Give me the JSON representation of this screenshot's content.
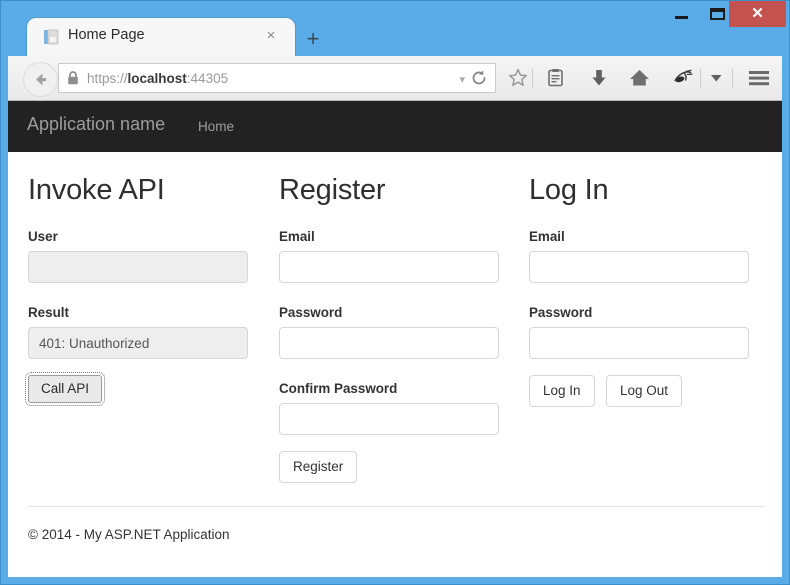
{
  "window": {
    "controls": {
      "minimize_label": "—",
      "maximize_label": "",
      "close_label": "✕"
    },
    "close_color": "#c4534f",
    "titlebar_color": "#5aace8"
  },
  "browser": {
    "tab": {
      "title": "Home Page",
      "close_label": "×",
      "favicon": "page-icon"
    },
    "new_tab_label": "+",
    "back_label": "back-arrow-icon",
    "url": {
      "scheme": "https://",
      "host": "localhost",
      "port": ":44305",
      "full": "https://localhost:44305",
      "lock": "padlock-icon",
      "dropdown_label": "▾",
      "reload_label": "reload-icon"
    },
    "toolbar_icons": [
      {
        "name": "star-icon",
        "label": "Bookmark"
      },
      {
        "name": "reader-icon",
        "label": "Reader view"
      },
      {
        "name": "download-icon",
        "label": "Downloads"
      },
      {
        "name": "home-icon",
        "label": "Home"
      },
      {
        "name": "pocket-icon",
        "label": "Pocket"
      },
      {
        "name": "chevron-down-icon",
        "label": "More"
      },
      {
        "name": "hamburger-menu-icon",
        "label": "Menu"
      }
    ]
  },
  "site": {
    "navbar": {
      "brand": "Application name",
      "links": [
        {
          "label": "Home"
        }
      ],
      "background": "#222222",
      "text_color": "#9d9d9d"
    },
    "columns": {
      "invoke": {
        "heading": "Invoke API",
        "user_label": "User",
        "user_value": "",
        "result_label": "Result",
        "result_value": "401: Unauthorized",
        "button_label": "Call API"
      },
      "register": {
        "heading": "Register",
        "email_label": "Email",
        "email_value": "",
        "password_label": "Password",
        "password_value": "",
        "confirm_label": "Confirm Password",
        "confirm_value": "",
        "button_label": "Register"
      },
      "login": {
        "heading": "Log In",
        "email_label": "Email",
        "email_value": "",
        "password_label": "Password",
        "password_value": "",
        "login_button_label": "Log In",
        "logout_button_label": "Log Out"
      }
    },
    "footer": {
      "text": "© 2014 - My ASP.NET Application"
    }
  }
}
